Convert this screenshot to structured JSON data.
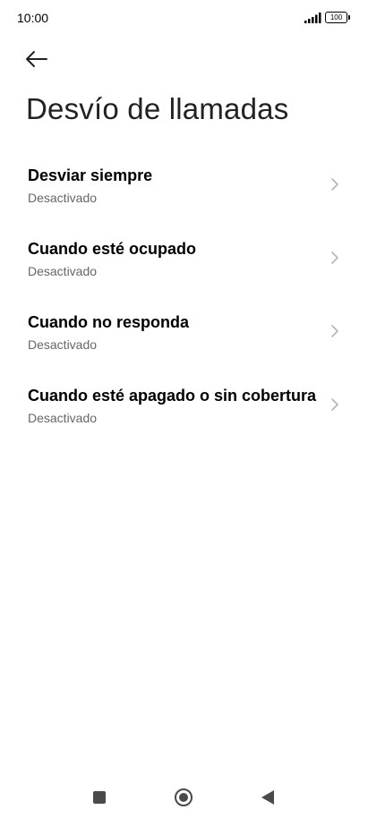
{
  "status_bar": {
    "time": "10:00",
    "battery": "100",
    "icons": [
      "signal-icon",
      "battery-icon"
    ]
  },
  "header": {
    "back_icon": "arrow-left-icon",
    "title": "Desvío de llamadas"
  },
  "settings": {
    "items": [
      {
        "title": "Desviar siempre",
        "subtitle": "Desactivado",
        "icon": "chevron-right-icon"
      },
      {
        "title": "Cuando esté ocupado",
        "subtitle": "Desactivado",
        "icon": "chevron-right-icon"
      },
      {
        "title": "Cuando no responda",
        "subtitle": "Desactivado",
        "icon": "chevron-right-icon"
      },
      {
        "title": "Cuando esté apagado o sin cobertura",
        "subtitle": "Desactivado",
        "icon": "chevron-right-icon"
      }
    ]
  },
  "nav_bar": {
    "buttons": [
      "recents-square-icon",
      "home-circle-icon",
      "back-triangle-icon"
    ]
  },
  "colors": {
    "background": "#ffffff",
    "title": "#222222",
    "item_title": "#000000",
    "item_subtitle": "#666666",
    "chevron": "#b5b5b5",
    "nav_icon": "#4a4a4a"
  }
}
